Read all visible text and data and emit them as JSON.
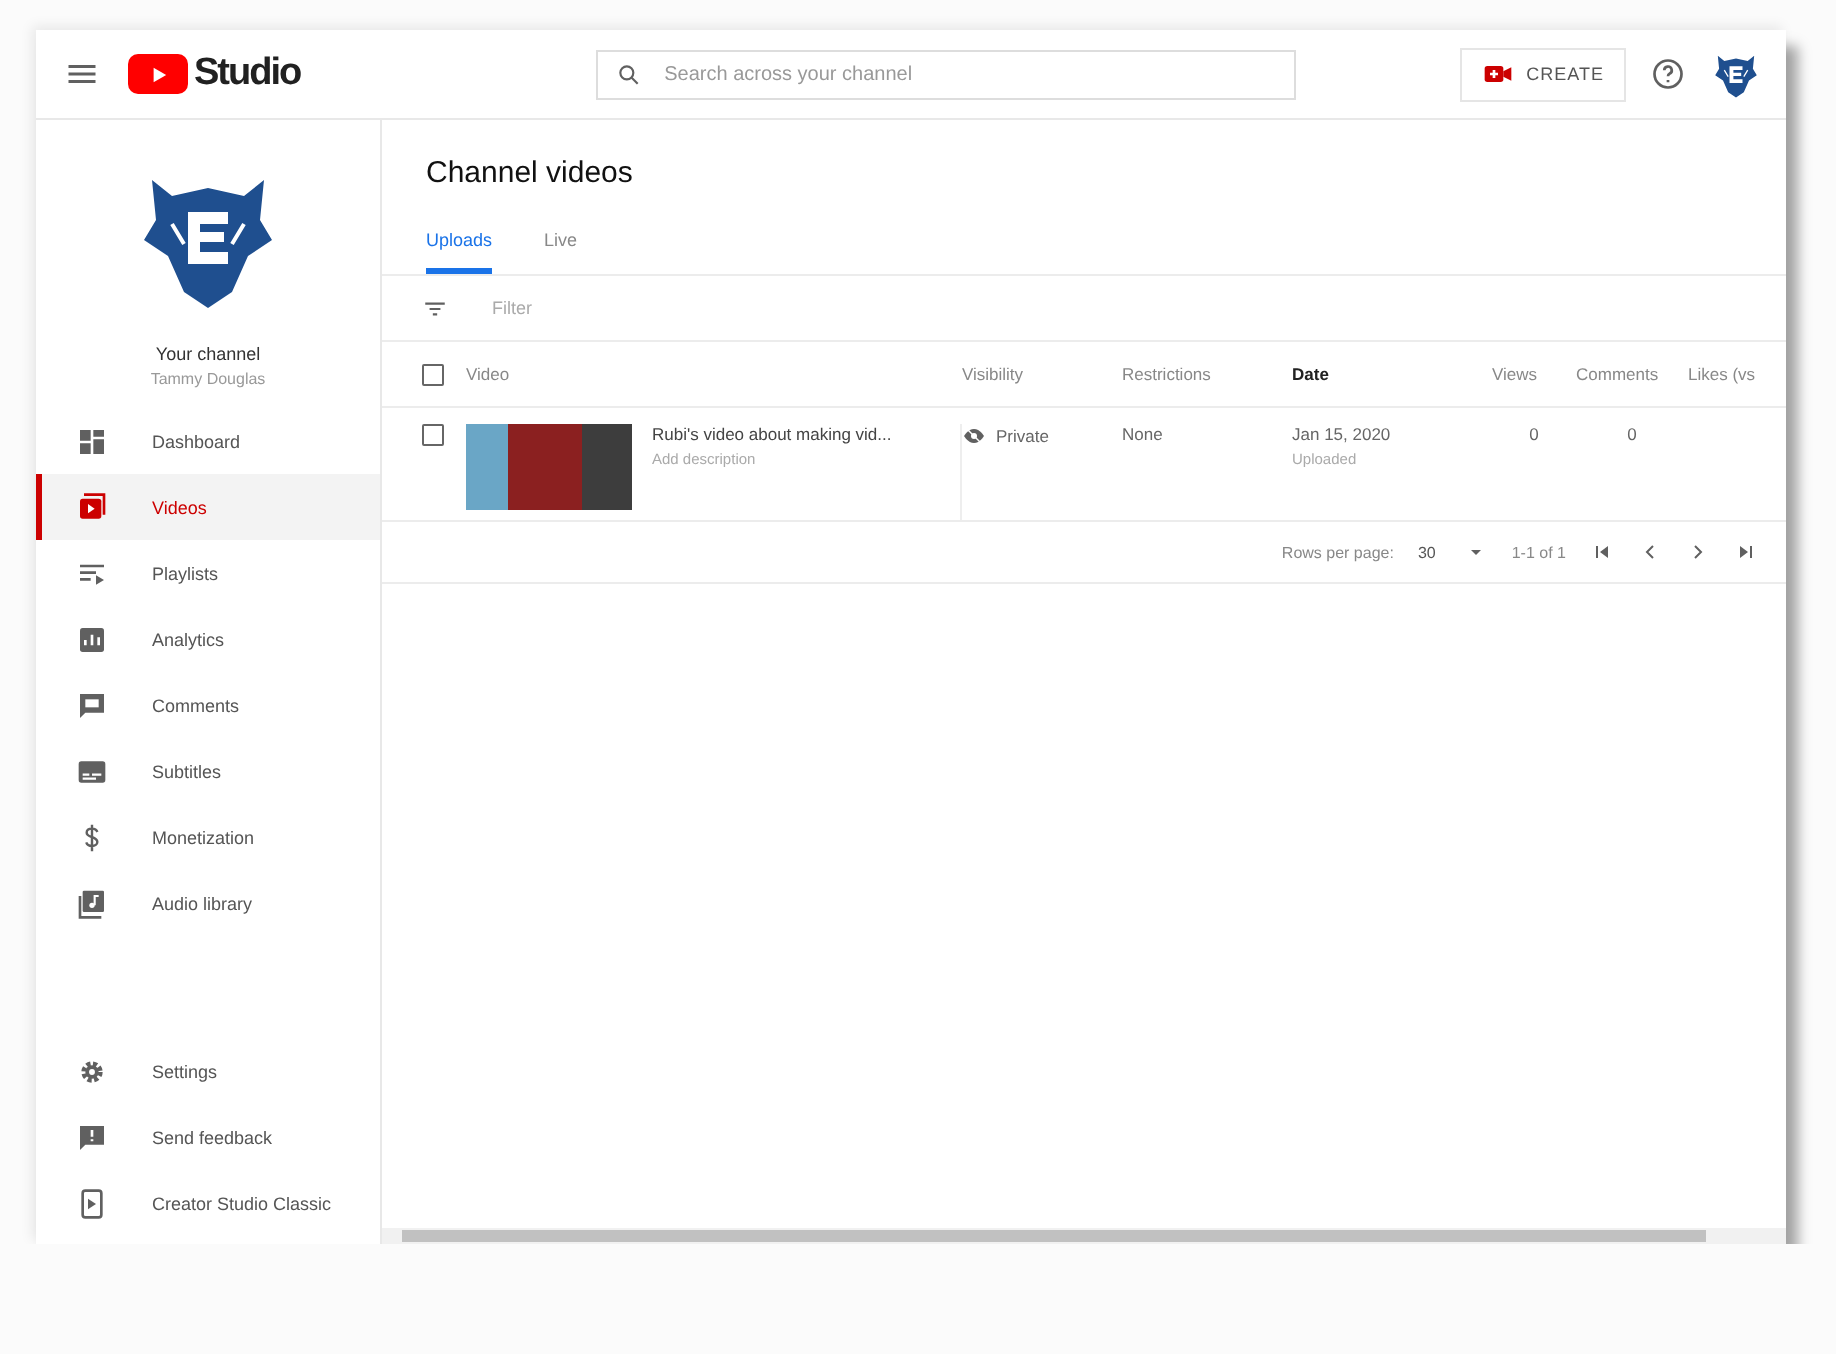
{
  "header": {
    "logo_text": "Studio",
    "search": {
      "placeholder": "Search across your channel"
    },
    "create_button": "CREATE"
  },
  "sidebar": {
    "channel_label": "Your channel",
    "channel_name": "Tammy Douglas",
    "items": [
      {
        "label": "Dashboard",
        "selected": false
      },
      {
        "label": "Videos",
        "selected": true
      },
      {
        "label": "Playlists",
        "selected": false
      },
      {
        "label": "Analytics",
        "selected": false
      },
      {
        "label": "Comments",
        "selected": false
      },
      {
        "label": "Subtitles",
        "selected": false
      },
      {
        "label": "Monetization",
        "selected": false
      },
      {
        "label": "Audio library",
        "selected": false
      }
    ],
    "footer_items": [
      {
        "label": "Settings",
        "selected": false
      },
      {
        "label": "Send feedback",
        "selected": false
      },
      {
        "label": "Creator Studio Classic",
        "selected": false
      }
    ]
  },
  "page": {
    "title": "Channel videos",
    "tabs": [
      {
        "label": "Uploads",
        "selected": true
      },
      {
        "label": "Live",
        "selected": false
      }
    ],
    "filter": {
      "placeholder": "Filter"
    },
    "table": {
      "select_all_checked": false,
      "columns": [
        {
          "label": "Video",
          "sorted": false
        },
        {
          "label": "Visibility",
          "sorted": false
        },
        {
          "label": "Restrictions",
          "sorted": false
        },
        {
          "label": "Date",
          "sorted": true
        },
        {
          "label": "Views",
          "sorted": false
        },
        {
          "label": "Comments",
          "sorted": false
        },
        {
          "label": "Likes (vs",
          "sorted": false
        }
      ],
      "rows": [
        {
          "checked": false,
          "title": "Rubi's video about making vid...",
          "description": "Add description",
          "visibility": "Private",
          "restrictions": "None",
          "date": "Jan 15, 2020",
          "date_status": "Uploaded",
          "views": "0",
          "comments": "0"
        }
      ]
    },
    "pagination": {
      "rows_per_page_label": "Rows per page:",
      "rows_per_page": "30",
      "range": "1-1 of 1"
    }
  }
}
